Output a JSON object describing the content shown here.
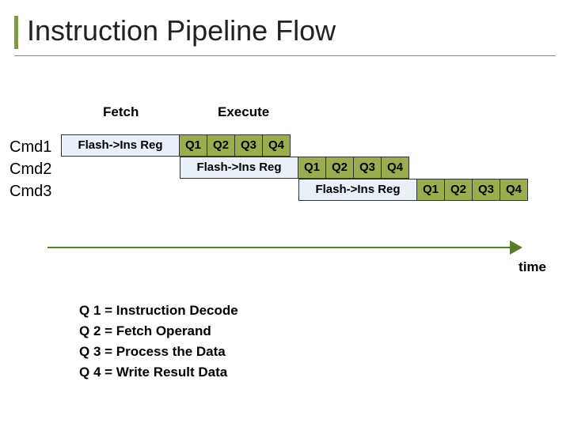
{
  "title": "Instruction Pipeline Flow",
  "stages": {
    "fetch": "Fetch",
    "execute": "Execute"
  },
  "commands": [
    "Cmd1",
    "Cmd2",
    "Cmd3"
  ],
  "fetch_cell": "Flash->Ins Reg",
  "q_cells": [
    "Q1",
    "Q2",
    "Q3",
    "Q4"
  ],
  "time_label": "time",
  "legend": [
    "Q 1 = Instruction Decode",
    "Q 2 = Fetch Operand",
    "Q 3 = Process the Data",
    "Q 4 = Write Result Data"
  ],
  "colors": {
    "accent": "#7a9a4a",
    "fetch_bg": "#eaf0f8",
    "q_bg": "#9aad4f",
    "arrow": "#5c7a2c"
  }
}
